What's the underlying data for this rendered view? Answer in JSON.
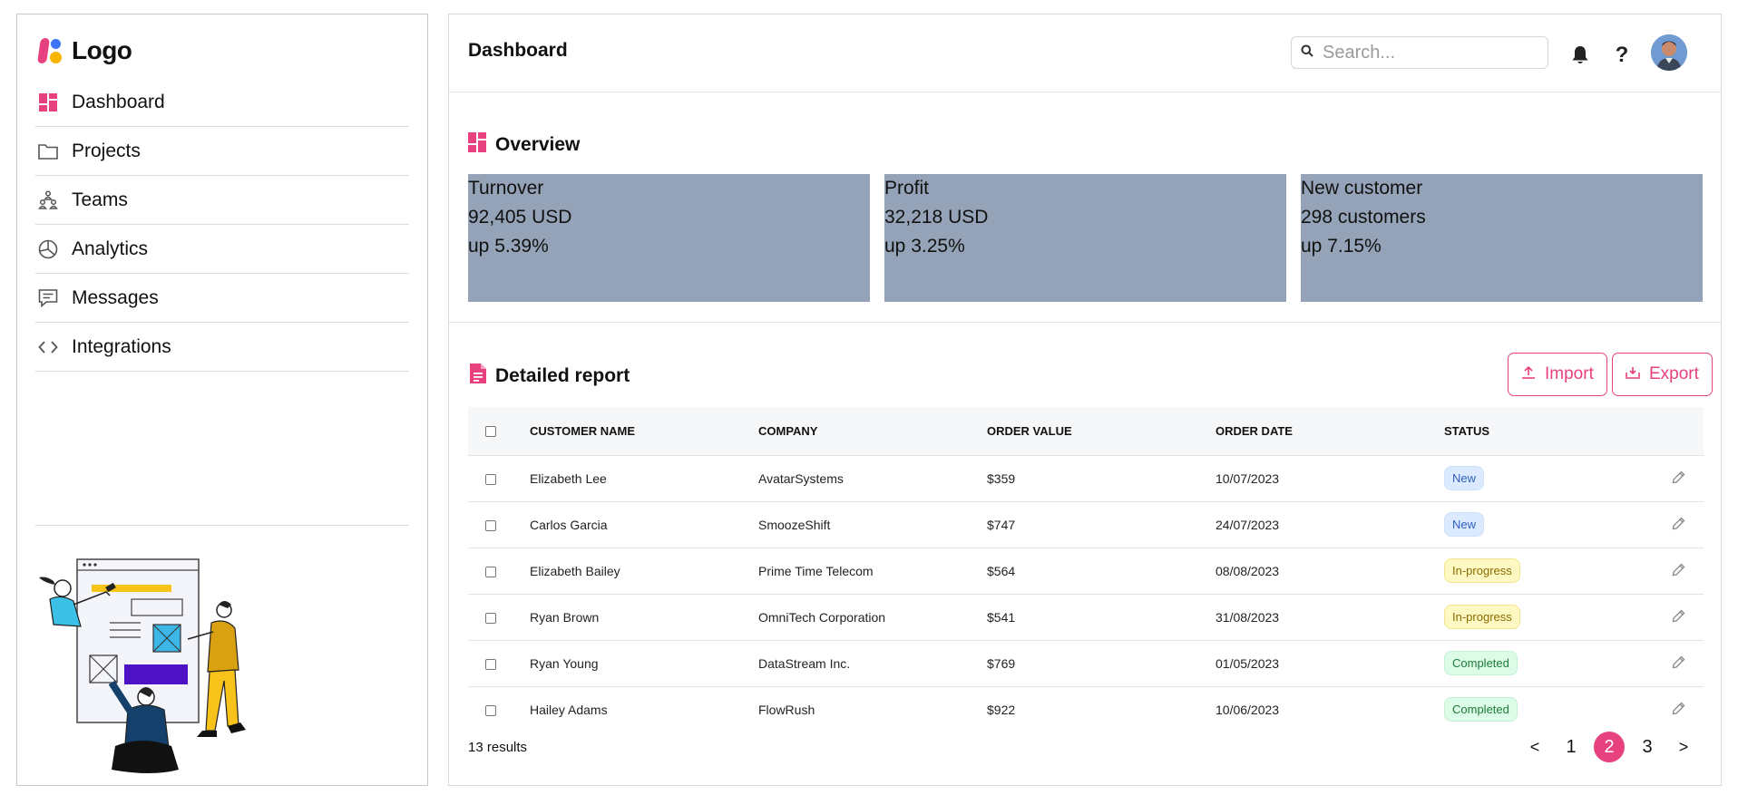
{
  "logo": {
    "text": "Logo"
  },
  "sidebar": {
    "items": [
      {
        "label": "Dashboard",
        "icon": "dashboard-icon"
      },
      {
        "label": "Projects",
        "icon": "folder-icon"
      },
      {
        "label": "Teams",
        "icon": "teams-icon"
      },
      {
        "label": "Analytics",
        "icon": "pie-chart-icon"
      },
      {
        "label": "Messages",
        "icon": "message-icon"
      },
      {
        "label": "Integrations",
        "icon": "code-icon"
      }
    ]
  },
  "header": {
    "title": "Dashboard",
    "search_placeholder": "Search...",
    "help_label": "?"
  },
  "overview": {
    "title": "Overview",
    "cards": [
      {
        "label": "Turnover",
        "value": "92,405 USD",
        "change": "up 5.39%"
      },
      {
        "label": "Profit",
        "value": "32,218 USD",
        "change": "up 3.25%"
      },
      {
        "label": "New customer",
        "value": "298 customers",
        "change": "up 7.15%"
      }
    ]
  },
  "report": {
    "title": "Detailed report",
    "import_label": "Import",
    "export_label": "Export",
    "columns": [
      "CUSTOMER NAME",
      "COMPANY",
      "ORDER VALUE",
      "ORDER DATE",
      "STATUS"
    ],
    "rows": [
      {
        "name": "Elizabeth Lee",
        "company": "AvatarSystems",
        "value": "$359",
        "date": "10/07/2023",
        "status": "New"
      },
      {
        "name": "Carlos Garcia",
        "company": "SmoozeShift",
        "value": "$747",
        "date": "24/07/2023",
        "status": "New"
      },
      {
        "name": "Elizabeth Bailey",
        "company": "Prime Time Telecom",
        "value": "$564",
        "date": "08/08/2023",
        "status": "In-progress"
      },
      {
        "name": "Ryan Brown",
        "company": "OmniTech Corporation",
        "value": "$541",
        "date": "31/08/2023",
        "status": "In-progress"
      },
      {
        "name": "Ryan Young",
        "company": "DataStream Inc.",
        "value": "$769",
        "date": "01/05/2023",
        "status": "Completed"
      },
      {
        "name": "Hailey Adams",
        "company": "FlowRush",
        "value": "$922",
        "date": "10/06/2023",
        "status": "Completed"
      }
    ],
    "results_text": "13 results",
    "pagination": {
      "prev": "<",
      "pages": [
        "1",
        "2",
        "3"
      ],
      "current": "2",
      "next": ">"
    }
  },
  "colors": {
    "accent": "#e8417f",
    "card_bg": "#94a3b8"
  }
}
